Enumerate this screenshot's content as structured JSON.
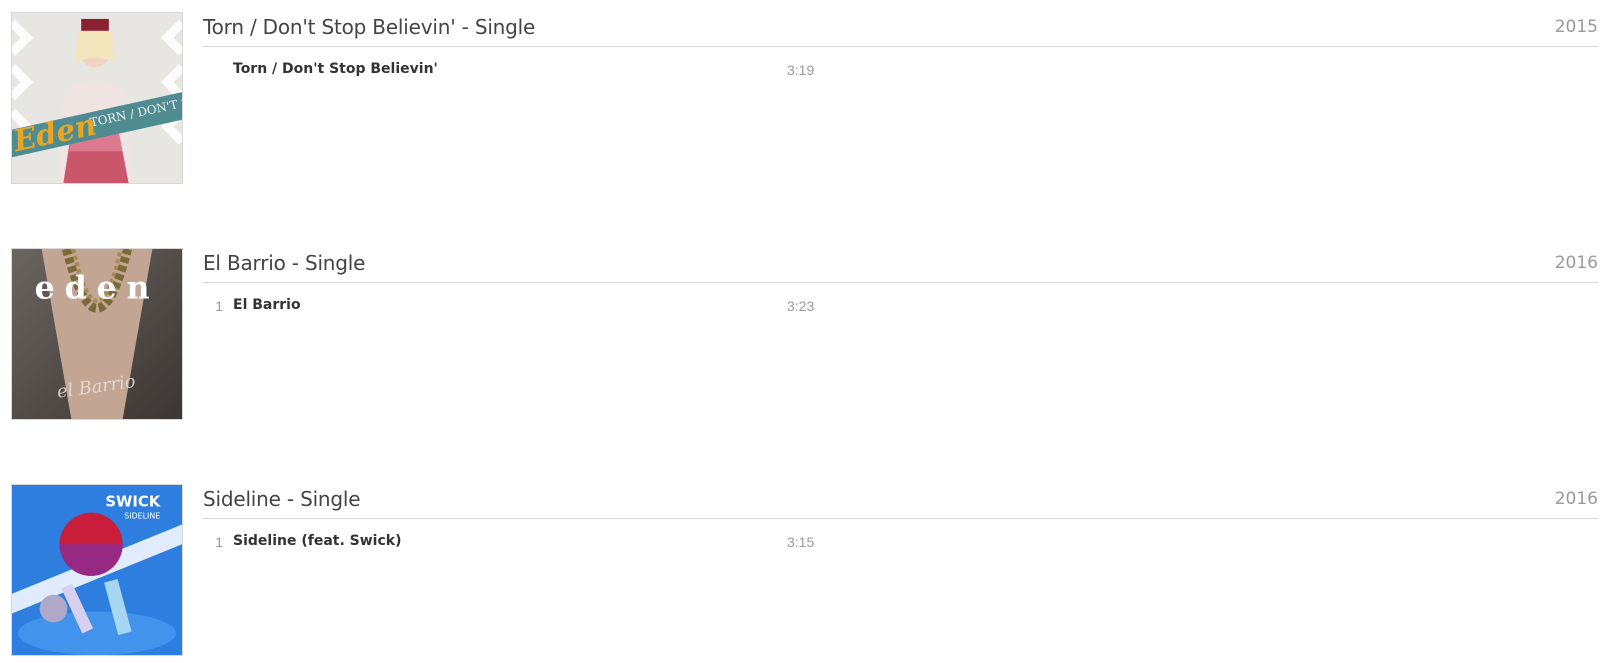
{
  "albums": [
    {
      "title": "Torn / Don't Stop Believin' - Single",
      "year": "2015",
      "cover_text": "Eden",
      "cover_subtext": "TORN / DON'T STOP BELIEVIN'",
      "tracks": [
        {
          "number": "",
          "name": "Torn / Don't Stop Believin'",
          "duration": "3:19"
        }
      ]
    },
    {
      "title": "El Barrio - Single",
      "year": "2016",
      "cover_text": "eden",
      "cover_subtext": "el Barrio",
      "tracks": [
        {
          "number": "1",
          "name": "El Barrio",
          "duration": "3:23"
        }
      ]
    },
    {
      "title": "Sideline - Single",
      "year": "2016",
      "cover_text": "SWICK",
      "cover_subtext": "SIDELINE",
      "tracks": [
        {
          "number": "1",
          "name": "Sideline (feat. Swick)",
          "duration": "3:15"
        }
      ]
    }
  ],
  "colors": {
    "divider": "#d6d6d6",
    "title": "#444444",
    "muted": "#9a9a9a"
  }
}
